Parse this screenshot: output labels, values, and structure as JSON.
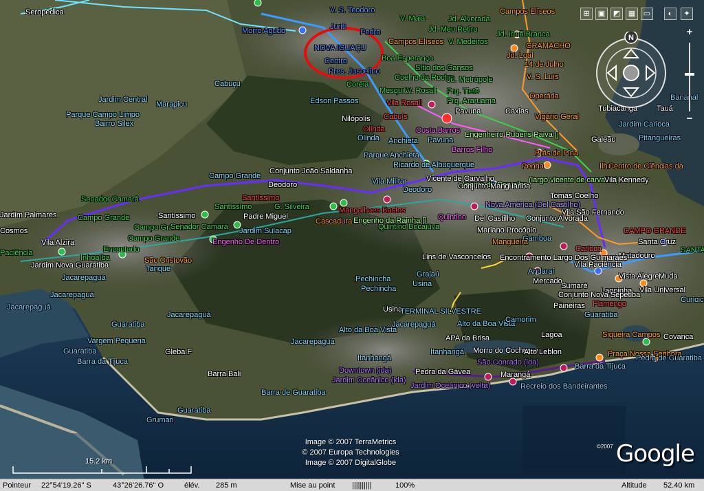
{
  "map": {
    "labels": [
      {
        "text": "Seropédica",
        "c": "white"
      },
      {
        "text": "V. S. Teodoro",
        "c": "blue"
      },
      {
        "text": "Juriti",
        "c": "blue"
      },
      {
        "text": "Morro Agudo",
        "c": "blue"
      },
      {
        "text": "V. Maia",
        "c": "green"
      },
      {
        "text": "Jd. Alvorada",
        "c": "green"
      },
      {
        "text": "Campos Elíseos",
        "c": "orange"
      },
      {
        "text": "Pedro",
        "c": "blue"
      },
      {
        "text": "Jd. Meu Retiro",
        "c": "green"
      },
      {
        "text": "Campos Elíseos",
        "c": "orange"
      },
      {
        "text": "V. Medeiros",
        "c": "green"
      },
      {
        "text": "Jd. Irmã Branca",
        "c": "green"
      },
      {
        "text": "NOVA IGUAÇU",
        "c": "blue"
      },
      {
        "text": "Boa Esperança",
        "c": "green"
      },
      {
        "text": "GRAMACHO",
        "c": "orange"
      },
      {
        "text": "Jd. Loal",
        "c": "orange"
      },
      {
        "text": "14 de Julho",
        "c": "orange"
      },
      {
        "text": "Centro",
        "c": "blue"
      },
      {
        "text": "Pres. Juscelino",
        "c": "blue"
      },
      {
        "text": "Sítio dos Gansos",
        "c": "green"
      },
      {
        "text": "Coelho da Rocha",
        "c": "green"
      },
      {
        "text": "Jd. Metrópole",
        "c": "green"
      },
      {
        "text": "V. S. Luís",
        "c": "orange"
      },
      {
        "text": "Jardim Central",
        "c": "cyan"
      },
      {
        "text": "Marapicu",
        "c": "cyan"
      },
      {
        "text": "Cabuçu",
        "c": "cyan"
      },
      {
        "text": "Coréia",
        "c": "green"
      },
      {
        "text": "Mesquita",
        "c": "green"
      },
      {
        "text": "V. Rosali",
        "c": "green"
      },
      {
        "text": "Prq. Tietê",
        "c": "green"
      },
      {
        "text": "Operária",
        "c": "orange"
      },
      {
        "text": "Parque Campo Limpo",
        "c": "cyan"
      },
      {
        "text": "Bairro Silex",
        "c": "cyan"
      },
      {
        "text": "Edson Passos",
        "c": "cyan"
      },
      {
        "text": "Vila Rosali",
        "c": "red"
      },
      {
        "text": "Prq. Araruama",
        "c": "green"
      },
      {
        "text": "Caxias",
        "c": "white"
      },
      {
        "text": "Pavuna",
        "c": "white"
      },
      {
        "text": "Vigário Geral",
        "c": "orange"
      },
      {
        "text": "Tubiacanga",
        "c": "white"
      },
      {
        "text": "Tauá",
        "c": "white"
      },
      {
        "text": "Bananal",
        "c": "cyan"
      },
      {
        "text": "Nilópolis",
        "c": "white"
      },
      {
        "text": "Cabuís",
        "c": "red"
      },
      {
        "text": "Olinda",
        "c": "red"
      },
      {
        "text": "Costa Barros",
        "c": "magenta"
      },
      {
        "text": "Olinda",
        "c": "cyan"
      },
      {
        "text": "Anchieta",
        "c": "cyan"
      },
      {
        "text": "Pavuna",
        "c": "cyan"
      },
      {
        "text": "Engenheiro Rubens Paiva []",
        "c": "lightgreen"
      },
      {
        "text": "Jardim Carioca",
        "c": "cyan"
      },
      {
        "text": "Barros Filho",
        "c": "magenta"
      },
      {
        "text": "Brás de Pina",
        "c": "orange"
      },
      {
        "text": "Galeão",
        "c": "white"
      },
      {
        "text": "Pitangueiras",
        "c": "cyan"
      },
      {
        "text": "Parque Anchieta",
        "c": "cyan"
      },
      {
        "text": "Ricardo de Albuquerque",
        "c": "cyan"
      },
      {
        "text": "Penha",
        "c": "orange"
      },
      {
        "text": "Ilha",
        "c": "orange"
      },
      {
        "text": "Centro de Ciências da",
        "c": "orange"
      },
      {
        "text": "Campo Grande",
        "c": "cyan"
      },
      {
        "text": "Conjunto João Saldanha",
        "c": "white"
      },
      {
        "text": "Vila Militar",
        "c": "cyan"
      },
      {
        "text": "Deodoro",
        "c": "cyan"
      },
      {
        "text": "Vicente de Carvalho",
        "c": "lightgreen"
      },
      {
        "text": "(largo vicente de carvalho)",
        "c": "lightgreen"
      },
      {
        "text": "Vila Kennedy",
        "c": "white"
      },
      {
        "text": "Deodoro",
        "c": "white"
      },
      {
        "text": "Vicente de Carvalho",
        "c": "white"
      },
      {
        "text": "Conjunto Manguariba",
        "c": "white"
      },
      {
        "text": "Senador Camará",
        "c": "green"
      },
      {
        "text": "Santíssimo",
        "c": "red"
      },
      {
        "text": "Santíssimo",
        "c": "green"
      },
      {
        "text": "G. Silveira",
        "c": "green"
      },
      {
        "text": "Mangalhaes Bastos",
        "c": "red"
      },
      {
        "text": "Engenho da Rainha []",
        "c": "lightgreen"
      },
      {
        "text": "Tomás Coelho",
        "c": "white"
      },
      {
        "text": "Nova América (Del Castilho)",
        "c": "violet"
      },
      {
        "text": "Vila São Fernando",
        "c": "white"
      },
      {
        "text": "Jardim Palmares",
        "c": "white"
      },
      {
        "text": "Campo Grande",
        "c": "green"
      },
      {
        "text": "Santíssimo",
        "c": "white"
      },
      {
        "text": "Padre Miguel",
        "c": "white"
      },
      {
        "text": "Cascadura",
        "c": "orange"
      },
      {
        "text": "Quintino",
        "c": "magenta"
      },
      {
        "text": "Del Castilho",
        "c": "white"
      },
      {
        "text": "Conjunto Alvorada",
        "c": "white"
      },
      {
        "text": "Cosmos",
        "c": "white"
      },
      {
        "text": "Campo Grande",
        "c": "green"
      },
      {
        "text": "Senador Camará",
        "c": "green"
      },
      {
        "text": "Jardim Sulacap",
        "c": "cyan"
      },
      {
        "text": "Quintino Bocaiúva",
        "c": "green"
      },
      {
        "text": "Mariano Procópio",
        "c": "white"
      },
      {
        "text": "CAMPO GRANDE",
        "c": "red"
      },
      {
        "text": "Campo Grande",
        "c": "green"
      },
      {
        "text": "Engenho De Dentro",
        "c": "magenta"
      },
      {
        "text": "Gamboa",
        "c": "cyan"
      },
      {
        "text": "Santa Cruz",
        "c": "white"
      },
      {
        "text": "Vila Alzira",
        "c": "white"
      },
      {
        "text": "Encantado",
        "c": "green"
      },
      {
        "text": "Mangueira",
        "c": "orange"
      },
      {
        "text": "Carioca",
        "c": "red"
      },
      {
        "text": "SANTA CRUZ",
        "c": "green"
      },
      {
        "text": "Paciência",
        "c": "green"
      },
      {
        "text": "Inhoaíba",
        "c": "green"
      },
      {
        "text": "São Cristovão",
        "c": "orange"
      },
      {
        "text": "Matadouro",
        "c": "white"
      },
      {
        "text": "Jardim Nova Guaratiba",
        "c": "white"
      },
      {
        "text": "Tanque",
        "c": "cyan"
      },
      {
        "text": "Lins de Vasconcelos",
        "c": "white"
      },
      {
        "text": "Encontramento Largo Dos Guimarães",
        "c": "white"
      },
      {
        "text": "Vila Paciência",
        "c": "white"
      },
      {
        "text": "Jacarepaguá",
        "c": "cyan"
      },
      {
        "text": "Pechincha",
        "c": "cyan"
      },
      {
        "text": "Grajaú",
        "c": "cyan"
      },
      {
        "text": "Andaraí",
        "c": "cyan"
      },
      {
        "text": "Mercado",
        "c": "white"
      },
      {
        "text": "Vista Alegre",
        "c": "white"
      },
      {
        "text": "Muda",
        "c": "white"
      },
      {
        "text": "Sumaré",
        "c": "white"
      },
      {
        "text": "Lagoinha",
        "c": "white"
      },
      {
        "text": "Vila Universal",
        "c": "white"
      },
      {
        "text": "Jacarepaguá",
        "c": "cyan"
      },
      {
        "text": "Pechincha",
        "c": "cyan"
      },
      {
        "text": "Usina",
        "c": "cyan"
      },
      {
        "text": "Conjunto Nova Sepetiba",
        "c": "white"
      },
      {
        "text": "Jacarepaguá",
        "c": "cyan"
      },
      {
        "text": "Usina",
        "c": "white"
      },
      {
        "text": "Paineiras",
        "c": "white"
      },
      {
        "text": "Flamengo",
        "c": "red"
      },
      {
        "text": "Curicica",
        "c": "cyan"
      },
      {
        "text": "TERMINAL SILVESTRE",
        "c": "cyan"
      },
      {
        "text": "Guaratiba",
        "c": "cyan"
      },
      {
        "text": "Guaratiba",
        "c": "cyan"
      },
      {
        "text": "Jacarepaguá",
        "c": "cyan"
      },
      {
        "text": "Jacarepaguá",
        "c": "cyan"
      },
      {
        "text": "Alto da Boa Vista",
        "c": "cyan"
      },
      {
        "text": "Camorim",
        "c": "cyan"
      },
      {
        "text": "Alto da Boa Vista",
        "c": "cyan"
      },
      {
        "text": "Lagoa",
        "c": "white"
      },
      {
        "text": "Siqueira Campos",
        "c": "orange"
      },
      {
        "text": "Covanca",
        "c": "white"
      },
      {
        "text": "Vargem Pequena",
        "c": "cyan"
      },
      {
        "text": "Jacarepaguá",
        "c": "cyan"
      },
      {
        "text": "APA da Brisa",
        "c": "white"
      },
      {
        "text": "Guaratiba",
        "c": "cyan"
      },
      {
        "text": "Gleba F",
        "c": "white"
      },
      {
        "text": "Itanhangá",
        "c": "cyan"
      },
      {
        "text": "Morro do Cochrane",
        "c": "white"
      },
      {
        "text": "Alto Leblon",
        "c": "white"
      },
      {
        "text": "Praça Nossa Senhora",
        "c": "orange"
      },
      {
        "text": "Pedra de Guaratiba",
        "c": "cyan"
      },
      {
        "text": "Barra da Tijuca",
        "c": "cyan"
      },
      {
        "text": "Itanhangá",
        "c": "cyan"
      },
      {
        "text": "São Conrado (ida)",
        "c": "purple"
      },
      {
        "text": "Barra da Tijuca",
        "c": "cyan"
      },
      {
        "text": "Downtown (ida)",
        "c": "purple"
      },
      {
        "text": "Pedra da Gávea",
        "c": "white"
      },
      {
        "text": "Marangá",
        "c": "white"
      },
      {
        "text": "Barra Bali",
        "c": "white"
      },
      {
        "text": "Jardim Oceânico (ida)",
        "c": "purple"
      },
      {
        "text": "Jardim Oceânico (volta)",
        "c": "purple"
      },
      {
        "text": "Recreio dos Bandeirantes",
        "c": "cyan"
      },
      {
        "text": "Barra de Guaratiba",
        "c": "cyan"
      },
      {
        "text": "Guaratiba",
        "c": "cyan"
      },
      {
        "text": "Grumari",
        "c": "cyan"
      }
    ]
  },
  "credits": [
    "Image © 2007 TerraMetrics",
    "© 2007 Europa Technologies",
    "Image © 2007 DigitalGlobe"
  ],
  "scale": {
    "label": "15.2 km"
  },
  "logo": {
    "text": "Google",
    "copy": "©2007"
  },
  "navigation": {
    "north": "N"
  },
  "zoom": {
    "plus": "+",
    "minus": "−"
  },
  "status": {
    "pointer_label": "Pointeur",
    "lat": "22°54'19.26\" S",
    "lon": "43°26'26.76\" O",
    "elev_label": "élév.",
    "elev": "285 m",
    "streaming_label": "Mise au point",
    "streaming_bar": "||||||||||",
    "streaming_pct": "100%",
    "altitude_label": "Altitude",
    "altitude": "52.40 km"
  }
}
